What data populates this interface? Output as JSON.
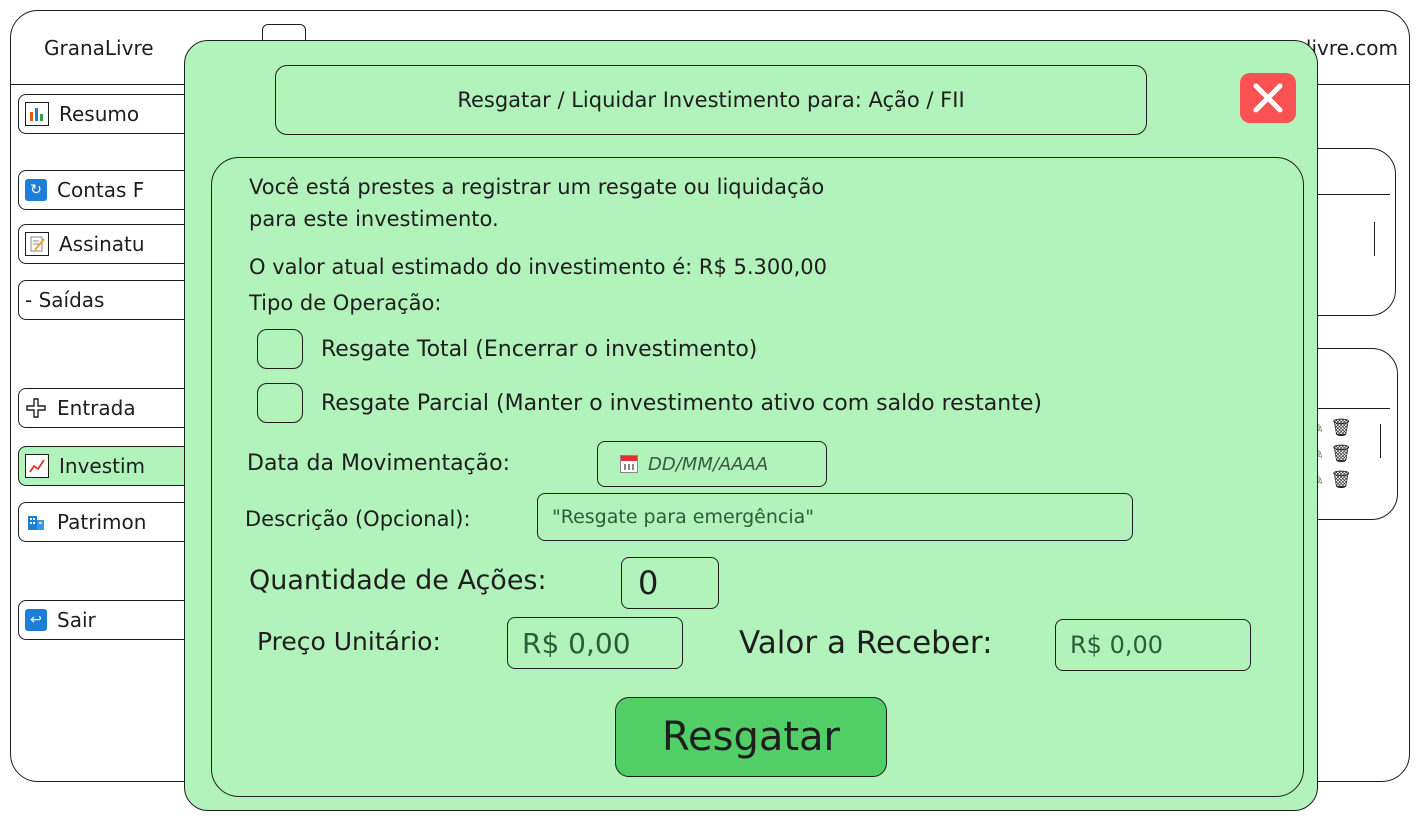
{
  "app": {
    "title": "GranaLivre",
    "url": "livre.com"
  },
  "sidebar": {
    "items": [
      {
        "label": "Resumo",
        "icon": "bar-chart-icon"
      },
      {
        "label": "Contas F",
        "icon": "refresh-icon"
      },
      {
        "label": "Assinatu",
        "icon": "memo-icon"
      },
      {
        "label": "- Saídas",
        "icon": ""
      },
      {
        "label": "Entrada",
        "icon": "plus-icon"
      },
      {
        "label": "Investim",
        "icon": "chart-increasing-icon"
      },
      {
        "label": "Patrimon",
        "icon": "building-icon"
      },
      {
        "label": "Sair",
        "icon": "return-icon"
      }
    ]
  },
  "modal": {
    "title": "Resgatar / Liquidar Investimento para: Ação / FII",
    "intro_line1": "Você está prestes a registrar um resgate ou liquidação",
    "intro_line2": "para este investimento.",
    "current_value": "O valor atual estimado do investimento é: R$ 5.300,00",
    "operation_label": "Tipo de Operação:",
    "option_total": "Resgate Total (Encerrar o investimento)",
    "option_partial": "Resgate Parcial (Manter o investimento ativo com saldo restante)",
    "date_label": "Data da Movimentação:",
    "date_placeholder": "DD/MM/AAAA",
    "description_label": "Descrição (Opcional):",
    "description_value": "\"Resgate para emergência\"",
    "quantity_label": "Quantidade de Ações:",
    "quantity_value": "0",
    "unit_price_label": "Preço Unitário:",
    "unit_price_value": "R$ 0,00",
    "receive_label": "Valor a Receber:",
    "receive_value": "R$ 0,00",
    "submit_label": "Resgatar"
  },
  "colors": {
    "modal_bg": "#b2f2bb",
    "submit_bg": "#51cf66",
    "close_bg": "#fa5252"
  }
}
